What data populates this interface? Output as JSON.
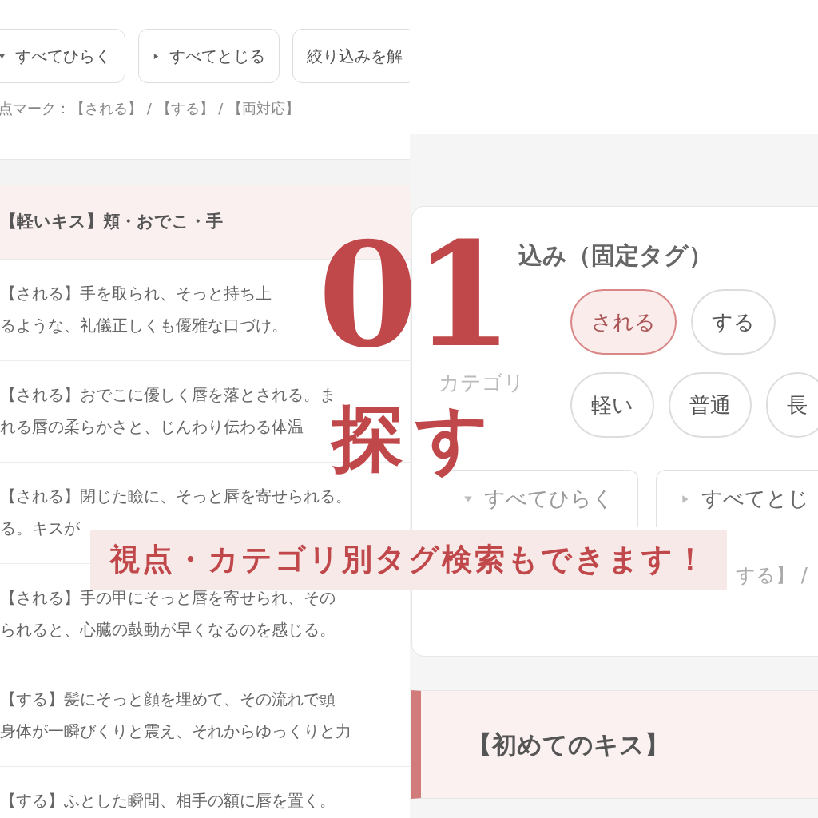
{
  "left_page": {
    "buttons": [
      {
        "kind": "expand",
        "label": "すべてひらく"
      },
      {
        "kind": "collapse",
        "label": "すべてとじる"
      },
      {
        "kind": "clear",
        "label": "絞り込みを解"
      }
    ],
    "legend": "点マーク：【される】 / 【する】 / 【両対応】",
    "section_title": "【軽いキス】頬・おでこ・手",
    "entries": [
      {
        "lines": [
          "【される】手を取られ、そっと持ち上",
          "るような、礼儀正しくも優雅な口づけ。"
        ]
      },
      {
        "lines": [
          "【される】おでこに優しく唇を落とされる。ま",
          "れる唇の柔らかさと、じんわり伝わる体温"
        ]
      },
      {
        "lines": [
          "【される】閉じた瞼に、そっと唇を寄せられる。",
          "る。キスが"
        ]
      },
      {
        "lines": [
          "【される】手の甲にそっと唇を寄せられ、その",
          "られると、心臓の鼓動が早くなるのを感じる。"
        ]
      },
      {
        "lines": [
          "【する】髪にそっと顔を埋めて、その流れで頭",
          "身体が一瞬びくりと震え、それからゆっくりと力"
        ]
      },
      {
        "lines": [
          "【する】ふとした瞬間、相手の額に唇を置く。"
        ]
      }
    ]
  },
  "right_page": {
    "filter_title": "込み（固定タグ）",
    "rows": [
      {
        "tags": [
          {
            "label": "される",
            "selected": true
          },
          {
            "label": "する",
            "selected": false
          }
        ]
      },
      {
        "label": "カテゴリ",
        "tags": [
          {
            "label": "軽い",
            "selected": false
          },
          {
            "label": "普通",
            "selected": false
          },
          {
            "label": "長",
            "selected": false
          }
        ]
      }
    ],
    "buttons": [
      {
        "kind": "expand",
        "label": "すべてひらく"
      },
      {
        "kind": "collapse",
        "label": "すべてとじ"
      }
    ],
    "legend": "する】 /",
    "section_title": "【初めてのキス】"
  },
  "overlay": {
    "number": "01",
    "title_lines": [
      "探",
      "す"
    ],
    "caption": "視点・カテゴリ別タグ検索もできます！"
  }
}
